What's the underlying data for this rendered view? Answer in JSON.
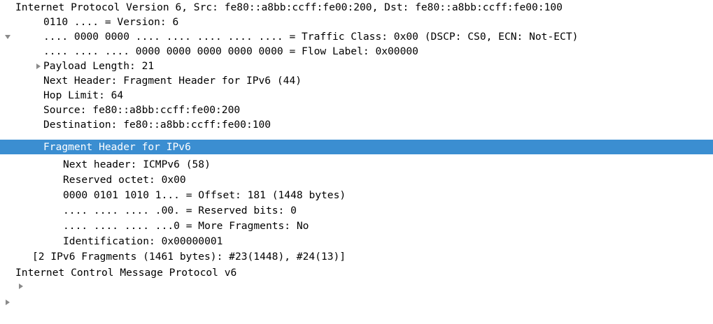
{
  "colors": {
    "selection_bg": "#3b8ed1",
    "selection_text": "#ffffff",
    "expander": "#8a8a8a"
  },
  "tree": {
    "ipv6": {
      "label": "Internet Protocol Version 6, Src: fe80::a8bb:ccff:fe00:200, Dst: fe80::a8bb:ccff:fe00:100",
      "expanded": true,
      "version": "0110 .... = Version: 6",
      "traffic_class": ".... 0000 0000 .... .... .... .... .... = Traffic Class: 0x00 (DSCP: CS0, ECN: Not-ECT)",
      "traffic_class_expanded": false,
      "flow_label": ".... .... .... 0000 0000 0000 0000 0000 = Flow Label: 0x00000",
      "payload_length": "Payload Length: 21",
      "next_header": "Next Header: Fragment Header for IPv6 (44)",
      "hop_limit": "Hop Limit: 64",
      "source": "Source: fe80::a8bb:ccff:fe00:200",
      "destination": "Destination: fe80::a8bb:ccff:fe00:100",
      "fragment_header": {
        "label": "Fragment Header for IPv6",
        "expanded": true,
        "selected": true,
        "next_header": "Next header: ICMPv6 (58)",
        "reserved_octet": "Reserved octet: 0x00",
        "offset": "0000 0101 1010 1... = Offset: 181 (1448 bytes)",
        "reserved_bits": ".... .... .... .00. = Reserved bits: 0",
        "more_fragments": ".... .... .... ...0 = More Fragments: No",
        "identification": "Identification: 0x00000001"
      },
      "fragments": "[2 IPv6 Fragments (1461 bytes): #23(1448), #24(13)]",
      "fragments_expanded": false
    },
    "icmpv6": {
      "label": "Internet Control Message Protocol v6",
      "expanded": false
    }
  }
}
